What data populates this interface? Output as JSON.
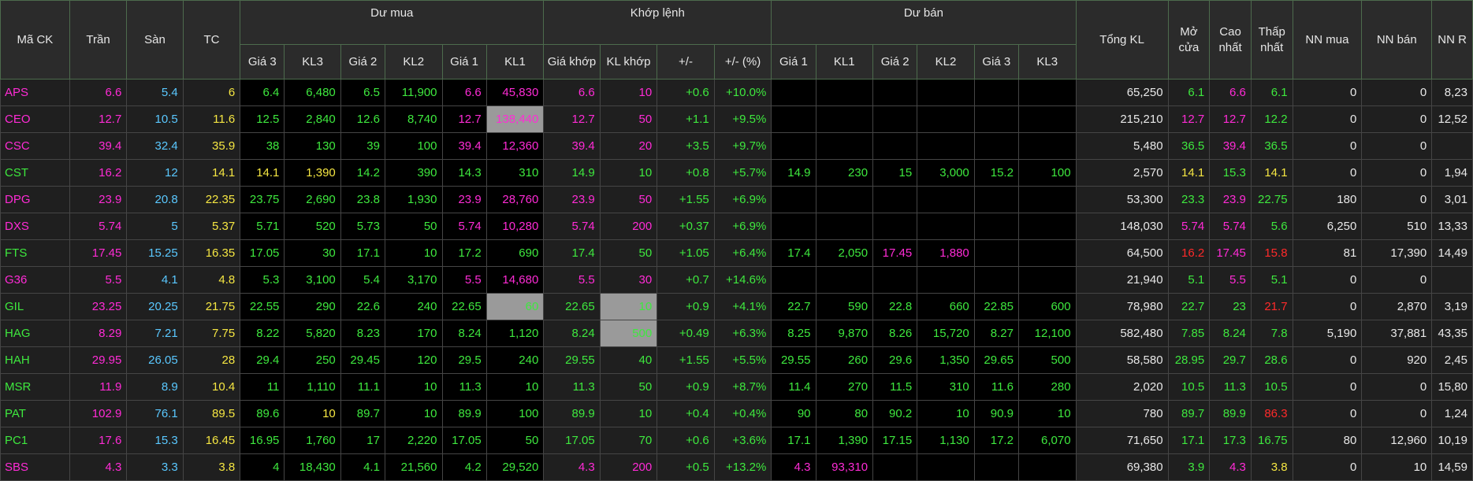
{
  "colors": {
    "ceil": "#ff2bd6",
    "floor": "#5ac8ff",
    "ref": "#f5e642",
    "up": "#3ee83e",
    "down": "#ff2a2a",
    "plain": "#e8e8e8"
  },
  "header": {
    "row1": [
      "Mã CK",
      "Trần",
      "Sàn",
      "TC",
      "Dư mua",
      "Khớp lệnh",
      "Dư bán",
      "Tổng KL",
      "Mở cửa",
      "Cao nhất",
      "Thấp nhất",
      "NN mua",
      "NN bán",
      "NN R"
    ],
    "buy": [
      "Giá 3",
      "KL3",
      "Giá 2",
      "KL2",
      "Giá 1",
      "KL1"
    ],
    "match": [
      "Giá khớp",
      "KL khớp",
      "+/-",
      "+/- (%)"
    ],
    "sell": [
      "Giá 1",
      "KL1",
      "Giá 2",
      "KL2",
      "Giá 3",
      "KL3"
    ]
  },
  "rows": [
    {
      "c": [
        "APS",
        "6.6",
        "5.4",
        "6",
        "6.4",
        "6,480",
        "6.5",
        "11,900",
        "6.6",
        "45,830",
        "6.6",
        "10",
        "+0.6",
        "+10.0%",
        "",
        "",
        "",
        "",
        "",
        "",
        "65,250",
        "6.1",
        "6.6",
        "6.1",
        "0",
        "0",
        "8,23"
      ],
      "s": [
        "c",
        "c",
        "f",
        "r",
        "u",
        "u",
        "u",
        "u",
        "c",
        "c",
        "c",
        "c",
        "u",
        "u",
        "",
        "",
        "",
        "",
        "",
        "",
        "p",
        "u",
        "c",
        "u",
        "p",
        "p",
        "p"
      ]
    },
    {
      "c": [
        "CEO",
        "12.7",
        "10.5",
        "11.6",
        "12.5",
        "2,840",
        "12.6",
        "8,740",
        "12.7",
        "138,440",
        "12.7",
        "50",
        "+1.1",
        "+9.5%",
        "",
        "",
        "",
        "",
        "",
        "",
        "215,210",
        "12.7",
        "12.7",
        "12.2",
        "0",
        "0",
        "12,52"
      ],
      "s": [
        "c",
        "c",
        "f",
        "r",
        "u",
        "u",
        "u",
        "u",
        "c",
        "c",
        "c",
        "c",
        "u",
        "u",
        "",
        "",
        "",
        "",
        "",
        "",
        "p",
        "c",
        "c",
        "u",
        "p",
        "p",
        "p"
      ]
    },
    {
      "c": [
        "CSC",
        "39.4",
        "32.4",
        "35.9",
        "38",
        "130",
        "39",
        "100",
        "39.4",
        "12,360",
        "39.4",
        "20",
        "+3.5",
        "+9.7%",
        "",
        "",
        "",
        "",
        "",
        "",
        "5,480",
        "36.5",
        "39.4",
        "36.5",
        "0",
        "0",
        ""
      ],
      "s": [
        "c",
        "c",
        "f",
        "r",
        "u",
        "u",
        "u",
        "u",
        "c",
        "c",
        "c",
        "c",
        "u",
        "u",
        "",
        "",
        "",
        "",
        "",
        "",
        "p",
        "u",
        "c",
        "u",
        "p",
        "p",
        "p"
      ]
    },
    {
      "c": [
        "CST",
        "16.2",
        "12",
        "14.1",
        "14.1",
        "1,390",
        "14.2",
        "390",
        "14.3",
        "310",
        "14.9",
        "10",
        "+0.8",
        "+5.7%",
        "14.9",
        "230",
        "15",
        "3,000",
        "15.2",
        "100",
        "2,570",
        "14.1",
        "15.3",
        "14.1",
        "0",
        "0",
        "1,94"
      ],
      "s": [
        "u",
        "c",
        "f",
        "r",
        "r",
        "r",
        "u",
        "u",
        "u",
        "u",
        "u",
        "u",
        "u",
        "u",
        "u",
        "u",
        "u",
        "u",
        "u",
        "u",
        "p",
        "r",
        "u",
        "r",
        "p",
        "p",
        "p"
      ]
    },
    {
      "c": [
        "DPG",
        "23.9",
        "20.8",
        "22.35",
        "23.75",
        "2,690",
        "23.8",
        "1,930",
        "23.9",
        "28,760",
        "23.9",
        "50",
        "+1.55",
        "+6.9%",
        "",
        "",
        "",
        "",
        "",
        "",
        "53,300",
        "23.3",
        "23.9",
        "22.75",
        "180",
        "0",
        "3,01"
      ],
      "s": [
        "c",
        "c",
        "f",
        "r",
        "u",
        "u",
        "u",
        "u",
        "c",
        "c",
        "c",
        "c",
        "u",
        "u",
        "",
        "",
        "",
        "",
        "",
        "",
        "p",
        "u",
        "c",
        "u",
        "p",
        "p",
        "p"
      ]
    },
    {
      "c": [
        "DXS",
        "5.74",
        "5",
        "5.37",
        "5.71",
        "520",
        "5.73",
        "50",
        "5.74",
        "10,280",
        "5.74",
        "200",
        "+0.37",
        "+6.9%",
        "",
        "",
        "",
        "",
        "",
        "",
        "148,030",
        "5.74",
        "5.74",
        "5.6",
        "6,250",
        "510",
        "13,33"
      ],
      "s": [
        "c",
        "c",
        "f",
        "r",
        "u",
        "u",
        "u",
        "u",
        "c",
        "c",
        "c",
        "c",
        "u",
        "u",
        "",
        "",
        "",
        "",
        "",
        "",
        "p",
        "c",
        "c",
        "u",
        "p",
        "p",
        "p"
      ]
    },
    {
      "c": [
        "FTS",
        "17.45",
        "15.25",
        "16.35",
        "17.05",
        "30",
        "17.1",
        "10",
        "17.2",
        "690",
        "17.4",
        "50",
        "+1.05",
        "+6.4%",
        "17.4",
        "2,050",
        "17.45",
        "1,880",
        "",
        "",
        "64,500",
        "16.2",
        "17.45",
        "15.8",
        "81",
        "17,390",
        "14,49"
      ],
      "s": [
        "u",
        "c",
        "f",
        "r",
        "u",
        "u",
        "u",
        "u",
        "u",
        "u",
        "u",
        "u",
        "u",
        "u",
        "u",
        "u",
        "c",
        "c",
        "",
        "",
        "p",
        "d",
        "c",
        "d",
        "p",
        "p",
        "p"
      ]
    },
    {
      "c": [
        "G36",
        "5.5",
        "4.1",
        "4.8",
        "5.3",
        "3,100",
        "5.4",
        "3,170",
        "5.5",
        "14,680",
        "5.5",
        "30",
        "+0.7",
        "+14.6%",
        "",
        "",
        "",
        "",
        "",
        "",
        "21,940",
        "5.1",
        "5.5",
        "5.1",
        "0",
        "0",
        ""
      ],
      "s": [
        "c",
        "c",
        "f",
        "r",
        "u",
        "u",
        "u",
        "u",
        "c",
        "c",
        "c",
        "c",
        "u",
        "u",
        "",
        "",
        "",
        "",
        "",
        "",
        "p",
        "u",
        "c",
        "u",
        "p",
        "p",
        "p"
      ]
    },
    {
      "c": [
        "GIL",
        "23.25",
        "20.25",
        "21.75",
        "22.55",
        "290",
        "22.6",
        "240",
        "22.65",
        "60",
        "22.65",
        "10",
        "+0.9",
        "+4.1%",
        "22.7",
        "590",
        "22.8",
        "660",
        "22.85",
        "600",
        "78,980",
        "22.7",
        "23",
        "21.7",
        "0",
        "2,870",
        "3,19"
      ],
      "s": [
        "u",
        "c",
        "f",
        "r",
        "u",
        "u",
        "u",
        "u",
        "u",
        "u",
        "u",
        "u",
        "u",
        "u",
        "u",
        "u",
        "u",
        "u",
        "u",
        "u",
        "p",
        "u",
        "u",
        "d",
        "p",
        "p",
        "p"
      ]
    },
    {
      "c": [
        "HAG",
        "8.29",
        "7.21",
        "7.75",
        "8.22",
        "5,820",
        "8.23",
        "170",
        "8.24",
        "1,120",
        "8.24",
        "500",
        "+0.49",
        "+6.3%",
        "8.25",
        "9,870",
        "8.26",
        "15,720",
        "8.27",
        "12,100",
        "582,480",
        "7.85",
        "8.24",
        "7.8",
        "5,190",
        "37,881",
        "43,35"
      ],
      "s": [
        "u",
        "c",
        "f",
        "r",
        "u",
        "u",
        "u",
        "u",
        "u",
        "u",
        "u",
        "u",
        "u",
        "u",
        "u",
        "u",
        "u",
        "u",
        "u",
        "u",
        "p",
        "u",
        "u",
        "u",
        "p",
        "p",
        "p"
      ]
    },
    {
      "c": [
        "HAH",
        "29.95",
        "26.05",
        "28",
        "29.4",
        "250",
        "29.45",
        "120",
        "29.5",
        "240",
        "29.55",
        "40",
        "+1.55",
        "+5.5%",
        "29.55",
        "260",
        "29.6",
        "1,350",
        "29.65",
        "500",
        "58,580",
        "28.95",
        "29.7",
        "28.6",
        "0",
        "920",
        "2,45"
      ],
      "s": [
        "u",
        "c",
        "f",
        "r",
        "u",
        "u",
        "u",
        "u",
        "u",
        "u",
        "u",
        "u",
        "u",
        "u",
        "u",
        "u",
        "u",
        "u",
        "u",
        "u",
        "p",
        "u",
        "u",
        "u",
        "p",
        "p",
        "p"
      ]
    },
    {
      "c": [
        "MSR",
        "11.9",
        "8.9",
        "10.4",
        "11",
        "1,110",
        "11.1",
        "10",
        "11.3",
        "10",
        "11.3",
        "50",
        "+0.9",
        "+8.7%",
        "11.4",
        "270",
        "11.5",
        "310",
        "11.6",
        "280",
        "2,020",
        "10.5",
        "11.3",
        "10.5",
        "0",
        "0",
        "15,80"
      ],
      "s": [
        "u",
        "c",
        "f",
        "r",
        "u",
        "u",
        "u",
        "u",
        "u",
        "u",
        "u",
        "u",
        "u",
        "u",
        "u",
        "u",
        "u",
        "u",
        "u",
        "u",
        "p",
        "u",
        "u",
        "u",
        "p",
        "p",
        "p"
      ]
    },
    {
      "c": [
        "PAT",
        "102.9",
        "76.1",
        "89.5",
        "89.6",
        "10",
        "89.7",
        "10",
        "89.9",
        "100",
        "89.9",
        "10",
        "+0.4",
        "+0.4%",
        "90",
        "80",
        "90.2",
        "10",
        "90.9",
        "10",
        "780",
        "89.7",
        "89.9",
        "86.3",
        "0",
        "0",
        "1,24"
      ],
      "s": [
        "u",
        "c",
        "f",
        "r",
        "u",
        "r",
        "u",
        "u",
        "u",
        "u",
        "u",
        "u",
        "u",
        "u",
        "u",
        "u",
        "u",
        "u",
        "u",
        "u",
        "p",
        "u",
        "u",
        "d",
        "p",
        "p",
        "p"
      ]
    },
    {
      "c": [
        "PC1",
        "17.6",
        "15.3",
        "16.45",
        "16.95",
        "1,760",
        "17",
        "2,220",
        "17.05",
        "50",
        "17.05",
        "70",
        "+0.6",
        "+3.6%",
        "17.1",
        "1,390",
        "17.15",
        "1,130",
        "17.2",
        "6,070",
        "71,650",
        "17.1",
        "17.3",
        "16.75",
        "80",
        "12,960",
        "10,19"
      ],
      "s": [
        "u",
        "c",
        "f",
        "r",
        "u",
        "u",
        "u",
        "u",
        "u",
        "u",
        "u",
        "u",
        "u",
        "u",
        "u",
        "u",
        "u",
        "u",
        "u",
        "u",
        "p",
        "u",
        "u",
        "u",
        "p",
        "p",
        "p"
      ]
    },
    {
      "c": [
        "SBS",
        "4.3",
        "3.3",
        "3.8",
        "4",
        "18,430",
        "4.1",
        "21,560",
        "4.2",
        "29,520",
        "4.3",
        "200",
        "+0.5",
        "+13.2%",
        "4.3",
        "93,310",
        "",
        "",
        "",
        "",
        "69,380",
        "3.9",
        "4.3",
        "3.8",
        "0",
        "10",
        "14,59"
      ],
      "s": [
        "c",
        "c",
        "f",
        "r",
        "u",
        "u",
        "u",
        "u",
        "u",
        "u",
        "c",
        "c",
        "u",
        "u",
        "c",
        "c",
        "",
        "",
        "",
        "",
        "p",
        "u",
        "c",
        "r",
        "p",
        "p",
        "p"
      ]
    }
  ]
}
